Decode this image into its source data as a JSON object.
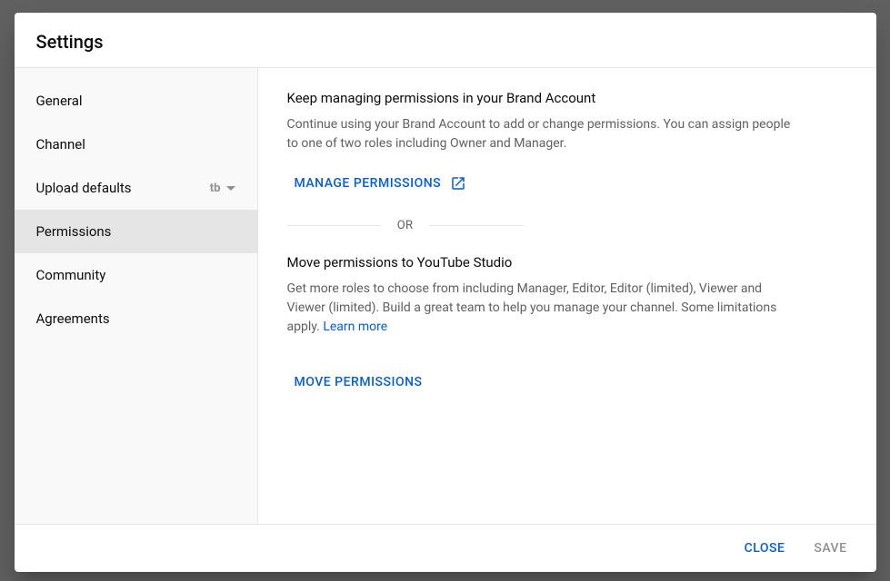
{
  "header": {
    "title": "Settings"
  },
  "sidebar": {
    "items": [
      {
        "label": "General"
      },
      {
        "label": "Channel"
      },
      {
        "label": "Upload defaults",
        "badge": "tb"
      },
      {
        "label": "Permissions"
      },
      {
        "label": "Community"
      },
      {
        "label": "Agreements"
      }
    ]
  },
  "content": {
    "section1": {
      "title": "Keep managing permissions in your Brand Account",
      "desc": "Continue using your Brand Account to add or change permissions. You can assign people to one of two roles including Owner and Manager.",
      "button": "Manage permissions"
    },
    "divider": "OR",
    "section2": {
      "title": "Move permissions to YouTube Studio",
      "desc_prefix": "Get more roles to choose from including Manager, Editor, Editor (limited), Viewer and Viewer (limited). Build a great team to help you manage your channel. Some limitations apply. ",
      "learn_more": "Learn more",
      "button": "Move permissions"
    }
  },
  "footer": {
    "close": "Close",
    "save": "Save"
  }
}
